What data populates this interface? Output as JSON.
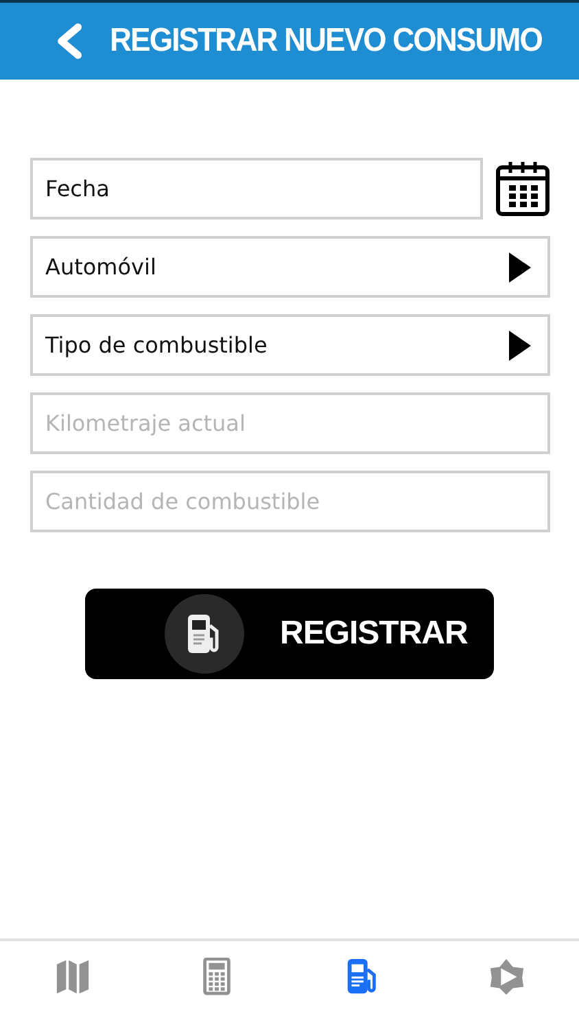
{
  "header": {
    "title": "REGISTRAR NUEVO CONSUMO"
  },
  "fields": [
    {
      "kind": "date",
      "value": "Fecha"
    },
    {
      "kind": "select",
      "value": "Automóvil"
    },
    {
      "kind": "select",
      "value": "Tipo de combustible"
    },
    {
      "kind": "input",
      "placeholder": "Kilometraje actual"
    },
    {
      "kind": "input",
      "placeholder": "Cantidad de combustible"
    }
  ],
  "submit": {
    "label": "REGISTRAR"
  },
  "tabs": [
    {
      "kind": "map",
      "selected": false
    },
    {
      "kind": "calculator",
      "selected": false
    },
    {
      "kind": "fuel",
      "selected": true
    },
    {
      "kind": "star",
      "selected": false
    }
  ]
}
